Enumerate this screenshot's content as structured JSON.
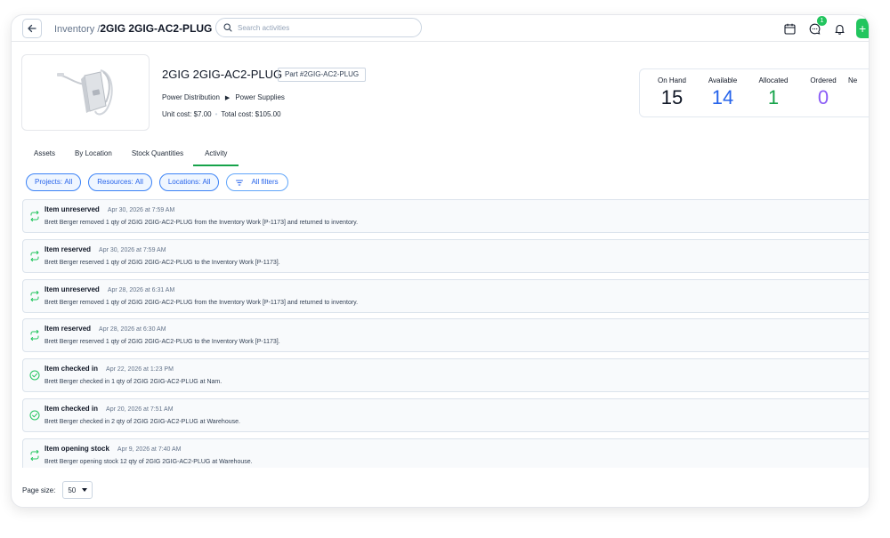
{
  "header": {
    "breadcrumb_parent": "Inventory",
    "breadcrumb_separator": "/",
    "breadcrumb_current": "2GIG 2GIG-AC2-PLUG",
    "search_placeholder": "Search activities",
    "notification_count": "1",
    "add_label": "+"
  },
  "product": {
    "title": "2GIG 2GIG-AC2-PLUG",
    "part_tag": "Part #2GIG-AC2-PLUG",
    "category": "Power Distribution",
    "subcategory": "Power Supplies",
    "unit_cost": "Unit cost: $7.00",
    "total_cost": "Total cost: $105.00"
  },
  "stats": [
    {
      "label": "On Hand",
      "value": "15",
      "color": "#111827"
    },
    {
      "label": "Available",
      "value": "14",
      "color": "#2563eb"
    },
    {
      "label": "Allocated",
      "value": "1",
      "color": "#16a34a"
    },
    {
      "label": "Ordered",
      "value": "0",
      "color": "#8b5cf6"
    },
    {
      "label": "Ne",
      "value": "",
      "color": "#f59e0b"
    }
  ],
  "tabs": [
    {
      "label": "Assets",
      "active": false
    },
    {
      "label": "By Location",
      "active": false
    },
    {
      "label": "Stock Quantities",
      "active": false
    },
    {
      "label": "Activity",
      "active": true
    }
  ],
  "filters": [
    {
      "label": "Projects:",
      "value": "All"
    },
    {
      "label": "Resources:",
      "value": "All"
    },
    {
      "label": "Locations:",
      "value": "All"
    }
  ],
  "all_filters_label": "All filters",
  "activities": [
    {
      "icon": "swap-icon",
      "title": "Item unreserved",
      "time": "Apr 30, 2026 at 7:59 AM",
      "desc": "Brett Berger removed 1 qty of 2GIG 2GIG-AC2-PLUG from the Inventory Work [P-1173] and returned to inventory."
    },
    {
      "icon": "swap-icon",
      "title": "Item reserved",
      "time": "Apr 30, 2026 at 7:59 AM",
      "desc": "Brett Berger reserved 1 qty of 2GIG 2GIG-AC2-PLUG to the Inventory Work [P-1173]."
    },
    {
      "icon": "swap-icon",
      "title": "Item unreserved",
      "time": "Apr 28, 2026 at 6:31 AM",
      "desc": "Brett Berger removed 1 qty of 2GIG 2GIG-AC2-PLUG from the Inventory Work [P-1173] and returned to inventory."
    },
    {
      "icon": "swap-icon",
      "title": "Item reserved",
      "time": "Apr 28, 2026 at 6:30 AM",
      "desc": "Brett Berger reserved 1 qty of 2GIG 2GIG-AC2-PLUG to the Inventory Work [P-1173]."
    },
    {
      "icon": "check-circle-icon",
      "title": "Item checked in",
      "time": "Apr 22, 2026 at 1:23 PM",
      "desc": "Brett Berger checked in 1 qty of 2GIG 2GIG-AC2-PLUG at Nam."
    },
    {
      "icon": "check-circle-icon",
      "title": "Item checked in",
      "time": "Apr 20, 2026 at 7:51 AM",
      "desc": "Brett Berger checked in 2 qty of 2GIG 2GIG-AC2-PLUG at Warehouse."
    },
    {
      "icon": "swap-icon",
      "title": "Item opening stock",
      "time": "Apr 9, 2026 at 7:40 AM",
      "desc": "Brett Berger opening stock 12 qty of 2GIG 2GIG-AC2-PLUG at Warehouse."
    }
  ],
  "footer": {
    "page_size_label": "Page size:",
    "page_size_value": "50"
  },
  "colors": {
    "accent_green": "#16a34a",
    "chip_blue": "#2563eb"
  }
}
